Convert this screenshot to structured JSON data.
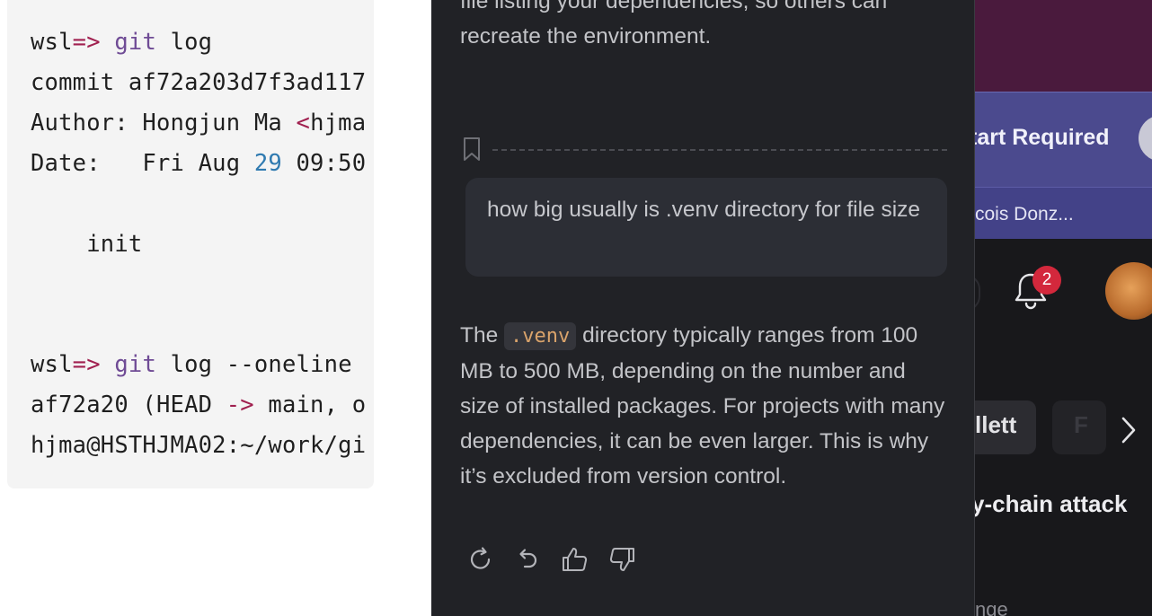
{
  "terminal": {
    "lines": [
      {
        "prompt": "wsl",
        "arrow": "=>",
        "cmd": "git",
        "rest": " log"
      },
      {
        "text": "commit af72a203d7f3ad117"
      },
      {
        "pre": "Author: Hongjun Ma ",
        "lt": "<",
        "post": "hjma"
      },
      {
        "pre": "Date:   Fri Aug ",
        "num": "29",
        "post": " 09:50"
      },
      {
        "text": "    init"
      },
      {
        "prompt": "wsl",
        "arrow": "=>",
        "cmd": "git",
        "rest": " log --oneline"
      },
      {
        "pre": "af72a20 (HEAD ",
        "arrow": "->",
        "post": " main, o"
      },
      {
        "text": "hjma@HSTHJMA02:~/work/gi"
      }
    ]
  },
  "chat": {
    "prev_answer_tail": "file listing your dependencies, so others can recreate the environment.",
    "user_message": "how big usually is .venv directory for file size",
    "answer": {
      "before_code": "The ",
      "code": ".venv",
      "after_code": " directory typically ranges from 100 MB to 500 MB, depending on the number and size of installed packages. For projects with many dependencies, it can be even larger. This is why it’s excluded from version control."
    },
    "actions": [
      "regenerate-icon",
      "undo-icon",
      "thumbs-up-icon",
      "thumbs-down-icon"
    ]
  },
  "right_app": {
    "banner_title": "tart Required",
    "banner_sub": "cois Donz...",
    "notification_count": "2",
    "chip_label": "llett",
    "chip2_label": "F",
    "headline": "y-chain attack",
    "faded_text": "nge"
  },
  "colors": {
    "chat_bg": "#212226",
    "code_bg": "#f4f4f4",
    "keyword": "#6f4b95",
    "arrow": "#a0204f",
    "number": "#2f7ab0",
    "inline_code": "#d9a36b",
    "badge": "#d3283c"
  }
}
